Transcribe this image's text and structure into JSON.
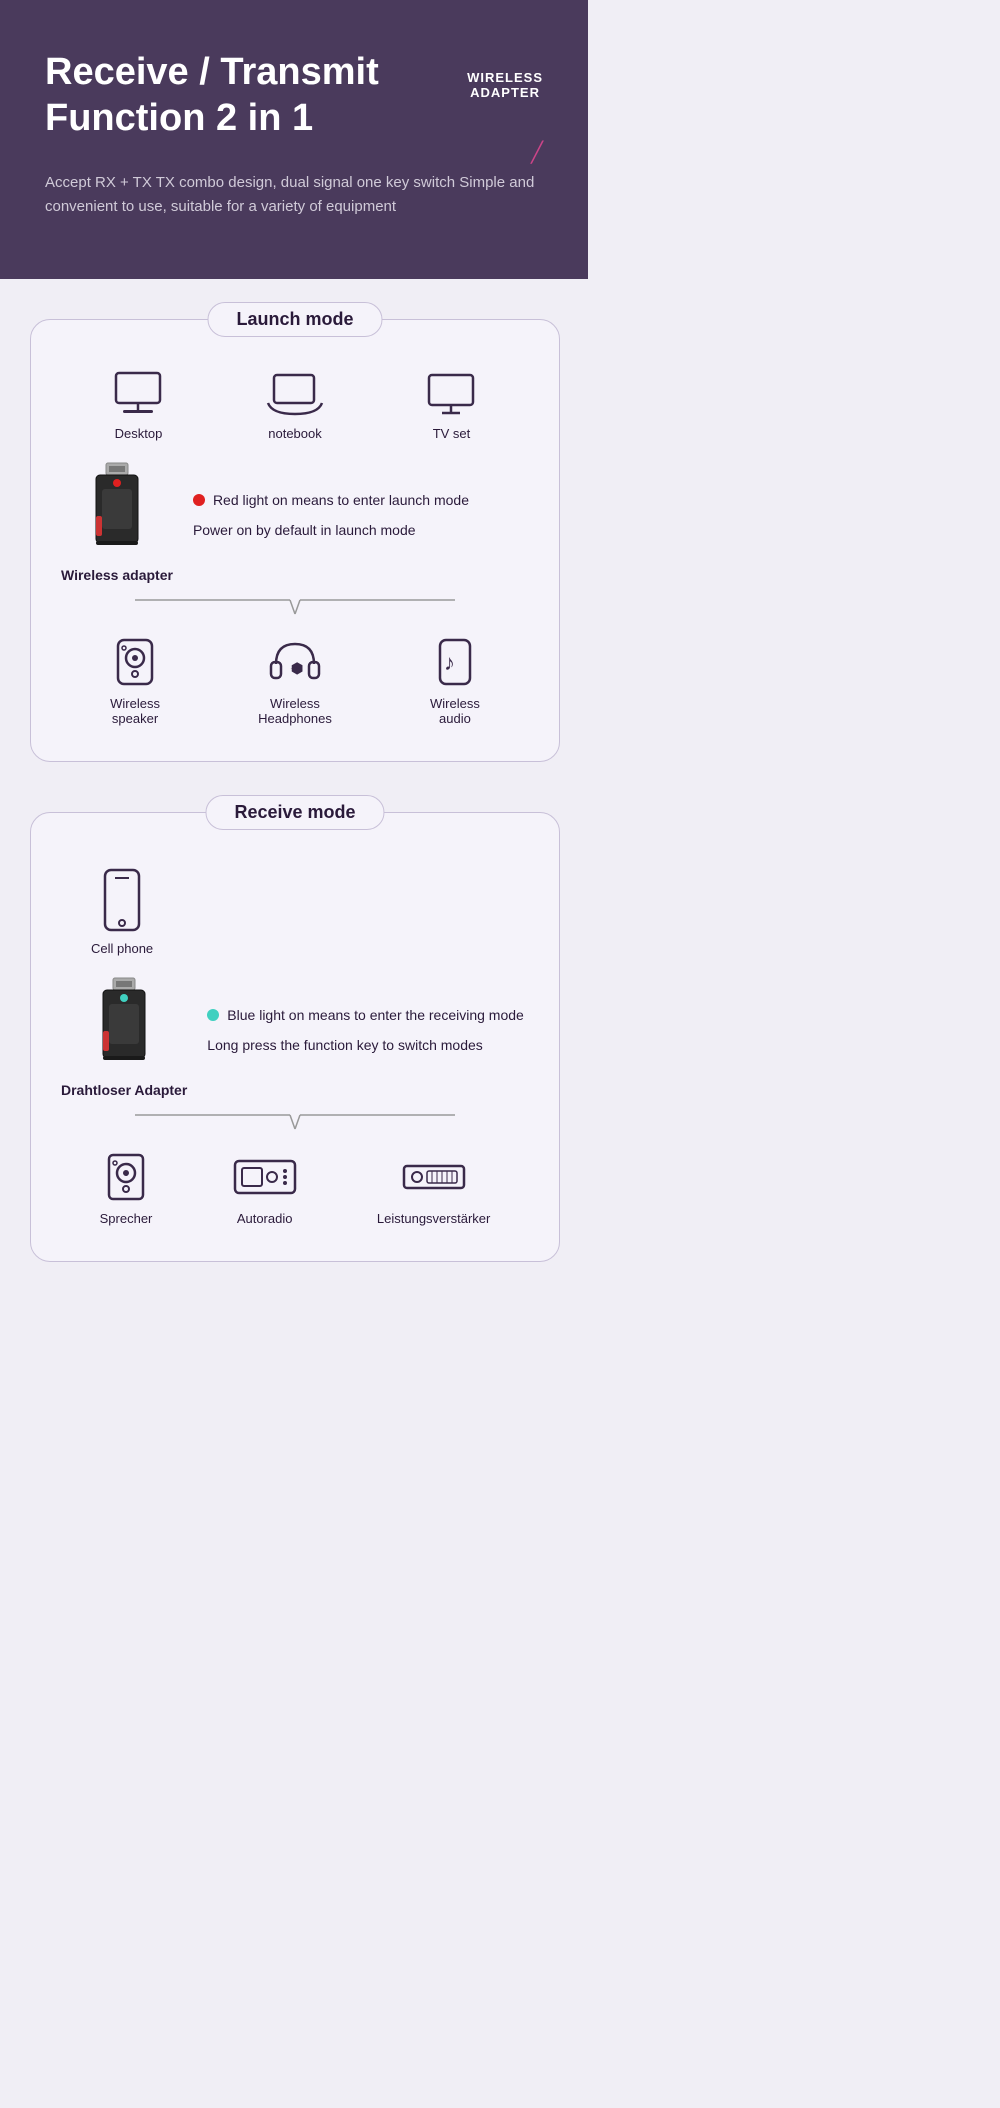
{
  "header": {
    "title_line1": "Receive / Transmit",
    "title_line2": "Function 2 in 1",
    "badge_line1": "WIRELESS",
    "badge_line2": "ADAPTER",
    "description": "Accept RX + TX TX combo design, dual signal one key switch\nSimple and convenient to use, suitable for a variety of equipment"
  },
  "launch_mode": {
    "label": "Launch mode",
    "top_devices": [
      {
        "id": "desktop",
        "label": "Desktop"
      },
      {
        "id": "notebook",
        "label": "notebook"
      },
      {
        "id": "tvset",
        "label": "TV set"
      }
    ],
    "adapter_label": "Wireless adapter",
    "info1": "Red light on means to enter launch mode",
    "info2": "Power on by default in launch mode",
    "bottom_devices": [
      {
        "id": "wireless-speaker",
        "label": "Wireless\nspeaker"
      },
      {
        "id": "wireless-headphones",
        "label": "Wireless\nHeadphones"
      },
      {
        "id": "wireless-audio",
        "label": "Wireless\naudio"
      }
    ]
  },
  "receive_mode": {
    "label": "Receive mode",
    "top_device_label": "Cell phone",
    "adapter_label": "Drahtloser Adapter",
    "info1": "Blue light on means to enter the receiving mode",
    "info2": "Long press the function key to switch modes",
    "bottom_devices": [
      {
        "id": "sprecher",
        "label": "Sprecher"
      },
      {
        "id": "autoradio",
        "label": "Autoradio"
      },
      {
        "id": "leistungsverstaerker",
        "label": "Leistungsverstärker"
      }
    ]
  }
}
